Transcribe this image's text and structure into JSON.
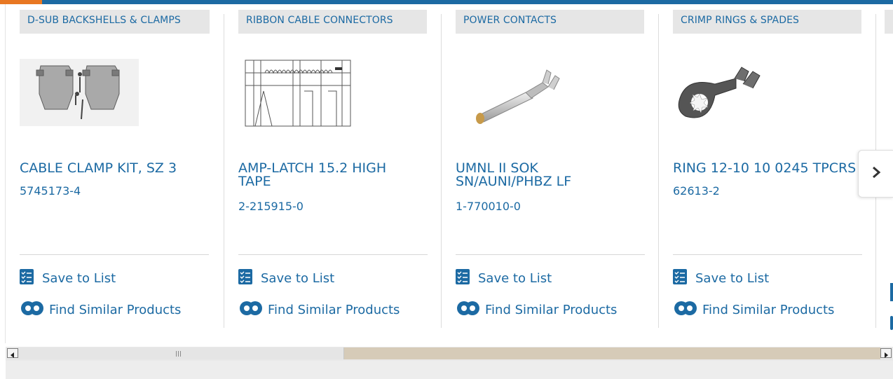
{
  "products": [
    {
      "category": "D-SUB BACKSHELLS & CLAMPS",
      "title": "CABLE CLAMP KIT, SZ 3",
      "part_number": "5745173-4",
      "save_label": "Save to List",
      "similar_label": "Find Similar Products",
      "image_icon": "dsub-backshell-image"
    },
    {
      "category": "RIBBON CABLE CONNECTORS",
      "title": "AMP-LATCH 15.2 HIGH TAPE",
      "part_number": "2-215915-0",
      "save_label": "Save to List",
      "similar_label": "Find Similar Products",
      "image_icon": "ribbon-connector-drawing"
    },
    {
      "category": "POWER CONTACTS",
      "title": "UMNL II SOK SN/AUNI/PHBZ LF",
      "part_number": "1-770010-0",
      "save_label": "Save to List",
      "similar_label": "Find Similar Products",
      "image_icon": "power-contact-image"
    },
    {
      "category": "CRIMP RINGS & SPADES",
      "title": "RING 12-10 10 0245 TPCRS",
      "part_number": "62613-2",
      "save_label": "Save to List",
      "similar_label": "Find Similar Products",
      "image_icon": "ring-terminal-image"
    }
  ],
  "controls": {
    "next_icon": "chevron-right-icon",
    "scroll_left_icon": "scroll-left-arrow-icon",
    "scroll_right_icon": "scroll-right-arrow-icon"
  },
  "colors": {
    "brand_blue": "#1c6aa3",
    "accent_orange": "#e87722",
    "category_bg": "#e6e6e6"
  }
}
